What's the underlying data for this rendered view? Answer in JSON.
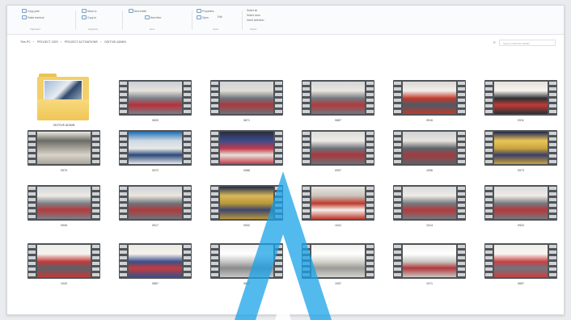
{
  "ribbon": {
    "groups": [
      {
        "label": "Clipboard",
        "buttons": [
          "Copy path",
          "Paste shortcut"
        ]
      },
      {
        "label": "Organize",
        "buttons": [
          "Move to",
          "Copy to"
        ]
      },
      {
        "label": "New",
        "buttons": [
          "New folder",
          "New item"
        ]
      },
      {
        "label": "Open",
        "buttons": [
          "Properties",
          "Open",
          "Edit"
        ]
      },
      {
        "label": "Select",
        "buttons": [
          "Select all",
          "Select none",
          "Invert selection"
        ]
      }
    ]
  },
  "address": {
    "crumbs": [
      "This PC",
      "PROJECT 2023",
      "PROJECT ACTIVATIONS",
      "ODITIVE ADMIN"
    ],
    "search_placeholder": "Search ODITIVE ADMIN"
  },
  "items": [
    {
      "type": "folder",
      "label": "ODITIVE ADMIN"
    },
    {
      "type": "video",
      "label": "0833",
      "tones": [
        "#c9cfd6",
        "#7a7f88",
        "#b8303a",
        "#e7e2dc"
      ]
    },
    {
      "type": "video",
      "label": "0871",
      "tones": [
        "#cfd3d8",
        "#6e737b",
        "#a83a3f",
        "#e2ddd7"
      ]
    },
    {
      "type": "video",
      "label": "0887",
      "tones": [
        "#d2d5d9",
        "#73777f",
        "#b03a3c",
        "#ebe6df"
      ]
    },
    {
      "type": "video",
      "label": "0916",
      "tones": [
        "#d8d8d4",
        "#c0392b",
        "#4e5a66",
        "#f3efe9"
      ]
    },
    {
      "type": "video",
      "label": "0911",
      "tones": [
        "#e5e0d8",
        "#2b2f33",
        "#c13b36",
        "#f6f3ef"
      ]
    },
    {
      "type": "video",
      "label": "0970",
      "tones": [
        "#ece8e0",
        "#a9a49b",
        "#d9d3ca",
        "#6b6b66"
      ]
    },
    {
      "type": "video",
      "label": "0972",
      "tones": [
        "#1f6fb3",
        "#e8e8e8",
        "#2b4a7a",
        "#cfd8e3"
      ]
    },
    {
      "type": "video",
      "label": "0986",
      "tones": [
        "#2a2d3a",
        "#c23a4a",
        "#e6e1d9",
        "#3b4c8c"
      ]
    },
    {
      "type": "video",
      "label": "0997",
      "tones": [
        "#dcdcda",
        "#6c7178",
        "#a9373c",
        "#efebe6"
      ]
    },
    {
      "type": "video",
      "label": "1056",
      "tones": [
        "#cfd3d8",
        "#5d6269",
        "#a23b3e",
        "#e8e3dd"
      ]
    },
    {
      "type": "video",
      "label": "0973",
      "tones": [
        "#1e2650",
        "#c8a23c",
        "#3a3f6a",
        "#e9c65a"
      ]
    },
    {
      "type": "video",
      "label": "0945",
      "tones": [
        "#d3d5d7",
        "#7b7f86",
        "#b5393c",
        "#eeeae5"
      ]
    },
    {
      "type": "video",
      "label": "0917",
      "tones": [
        "#cfd2d6",
        "#6f7379",
        "#ae3a3d",
        "#ebe6df"
      ]
    },
    {
      "type": "video",
      "label": "0932",
      "tones": [
        "#1f2a4a",
        "#b99739",
        "#3c4670",
        "#d9b85a"
      ]
    },
    {
      "type": "video",
      "label": "1041",
      "tones": [
        "#e9e6e1",
        "#c0392b",
        "#f4f1ec",
        "#c9c4bc"
      ]
    },
    {
      "type": "video",
      "label": "1014",
      "tones": [
        "#d8dadc",
        "#75797f",
        "#b3393c",
        "#efebe6"
      ]
    },
    {
      "type": "video",
      "label": "0922",
      "tones": [
        "#d9dbdd",
        "#74787e",
        "#b4383b",
        "#f0ece7"
      ]
    },
    {
      "type": "video",
      "label": "1043",
      "tones": [
        "#ececea",
        "#c23a3a",
        "#5a6068",
        "#f5f3ef"
      ]
    },
    {
      "type": "video",
      "label": "0857",
      "tones": [
        "#ebe8e2",
        "#3a4f8a",
        "#c53b3b",
        "#f6f3ee"
      ]
    },
    {
      "type": "video",
      "label": "0821",
      "tones": [
        "#f1f1f1",
        "#c7c7c7",
        "#8a8a8a",
        "#ffffff"
      ]
    },
    {
      "type": "video",
      "label": "1057",
      "tones": [
        "#f0efec",
        "#d5d3ce",
        "#9a9a96",
        "#ffffff"
      ]
    },
    {
      "type": "video",
      "label": "1071",
      "tones": [
        "#f2f1ee",
        "#c9c7c2",
        "#b2373b",
        "#ffffff"
      ]
    },
    {
      "type": "video",
      "label": "0857",
      "tones": [
        "#efeeea",
        "#c84040",
        "#6f7580",
        "#f8f6f3"
      ]
    }
  ],
  "colors": {
    "accent": "#1f9ce0",
    "folder": "#f3cf6a"
  }
}
